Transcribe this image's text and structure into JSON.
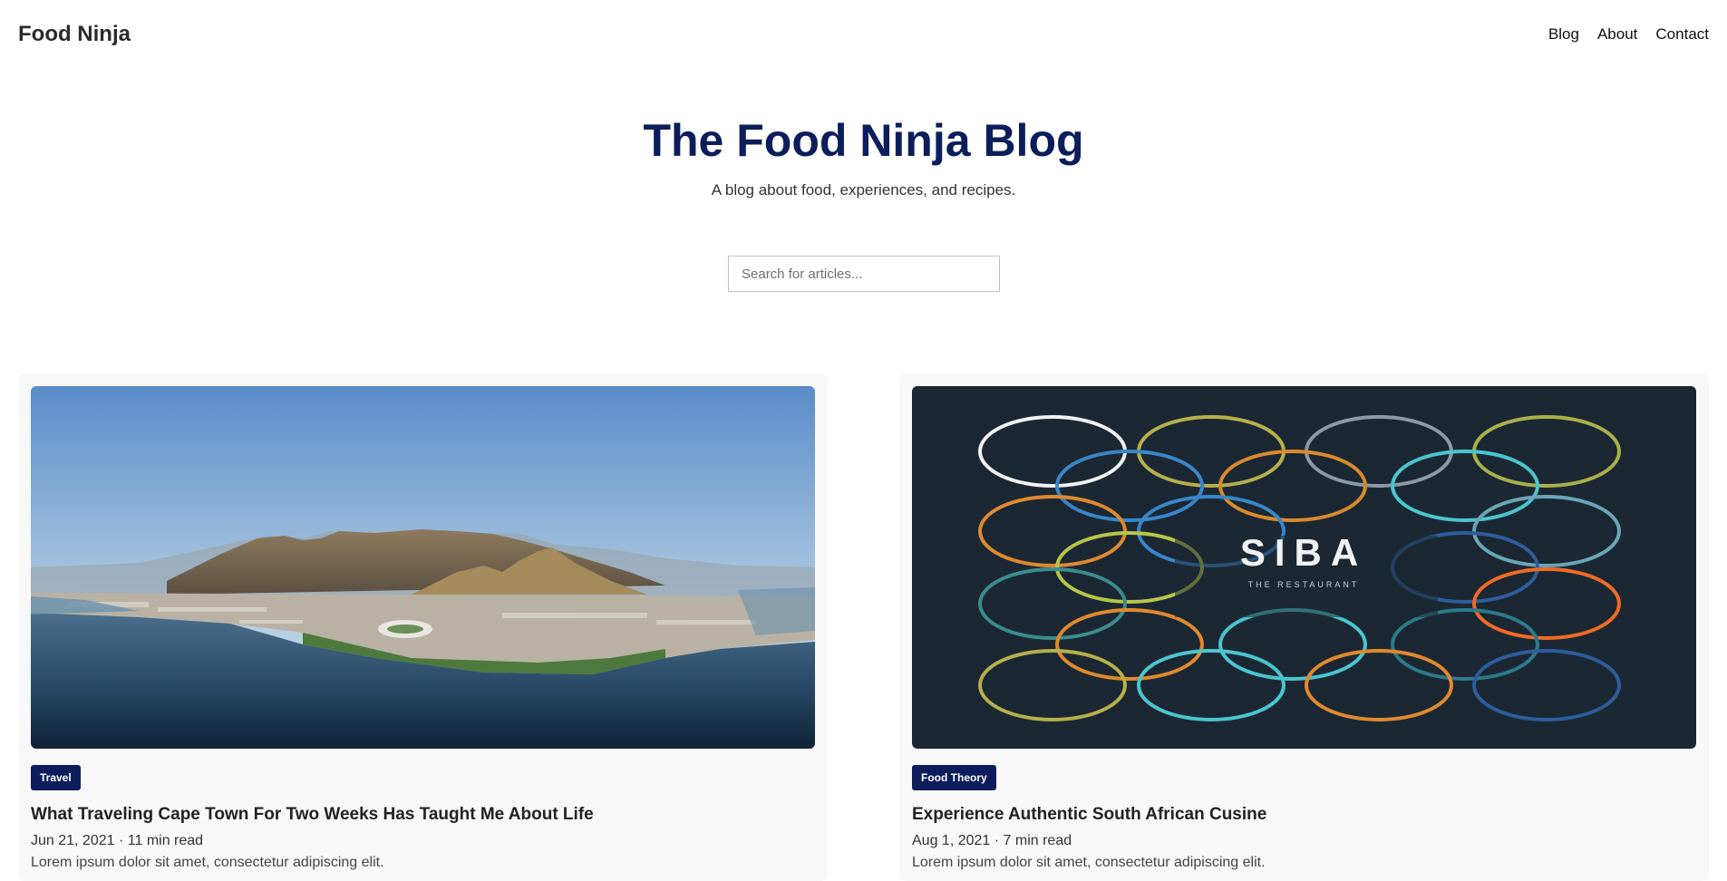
{
  "header": {
    "brand": "Food Ninja",
    "nav": [
      "Blog",
      "About",
      "Contact"
    ]
  },
  "hero": {
    "title": "The Food Ninja Blog",
    "subtitle": "A blog about food, experiences, and recipes."
  },
  "search": {
    "placeholder": "Search for articles...",
    "value": ""
  },
  "posts": [
    {
      "tag": "Travel",
      "title": "What Traveling Cape Town For Two Weeks Has Taught Me About Life",
      "date": "Jun 21, 2021",
      "read_time": "11 min read",
      "excerpt": "Lorem ipsum dolor sit amet, consectetur adipiscing elit.",
      "image": "cape-town-aerial-photo"
    },
    {
      "tag": "Food Theory",
      "title": "Experience Authentic South African Cusine",
      "date": "Aug 1, 2021",
      "read_time": "7 min read",
      "excerpt": "Lorem ipsum dolor sit amet, consectetur adipiscing elit.",
      "image": "siba-restaurant-logo",
      "image_text": {
        "name": "SIBA",
        "tagline": "THE RESTAURANT"
      }
    }
  ],
  "colors": {
    "accent": "#0b1e5b",
    "card_bg": "#f8f8f9",
    "siba_bg": "#1b2833"
  }
}
